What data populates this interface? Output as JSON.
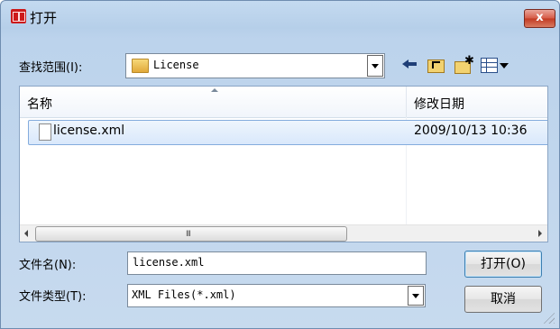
{
  "window": {
    "title": "打开",
    "close_label": "x"
  },
  "toolbar": {
    "look_in_label": "查找范围(I):",
    "look_in_value": "License",
    "icons": [
      "back-arrow-icon",
      "up-folder-icon",
      "new-folder-icon",
      "view-menu-icon"
    ]
  },
  "file_list": {
    "columns": [
      "名称",
      "修改日期"
    ],
    "rows": [
      {
        "name": "license.xml",
        "modified": "2009/10/13 10:36",
        "selected": true
      }
    ],
    "scroll_grip": "III"
  },
  "form": {
    "file_name_label": "文件名(N):",
    "file_name_value": "license.xml",
    "file_type_label": "文件类型(T):",
    "file_type_value": "XML Files(*.xml)"
  },
  "buttons": {
    "open_label": "打开(O)",
    "cancel_label": "取消"
  },
  "colors": {
    "accent_border": "#84acdd",
    "selection": "#d9e8fb",
    "close_button": "#c23a22"
  }
}
